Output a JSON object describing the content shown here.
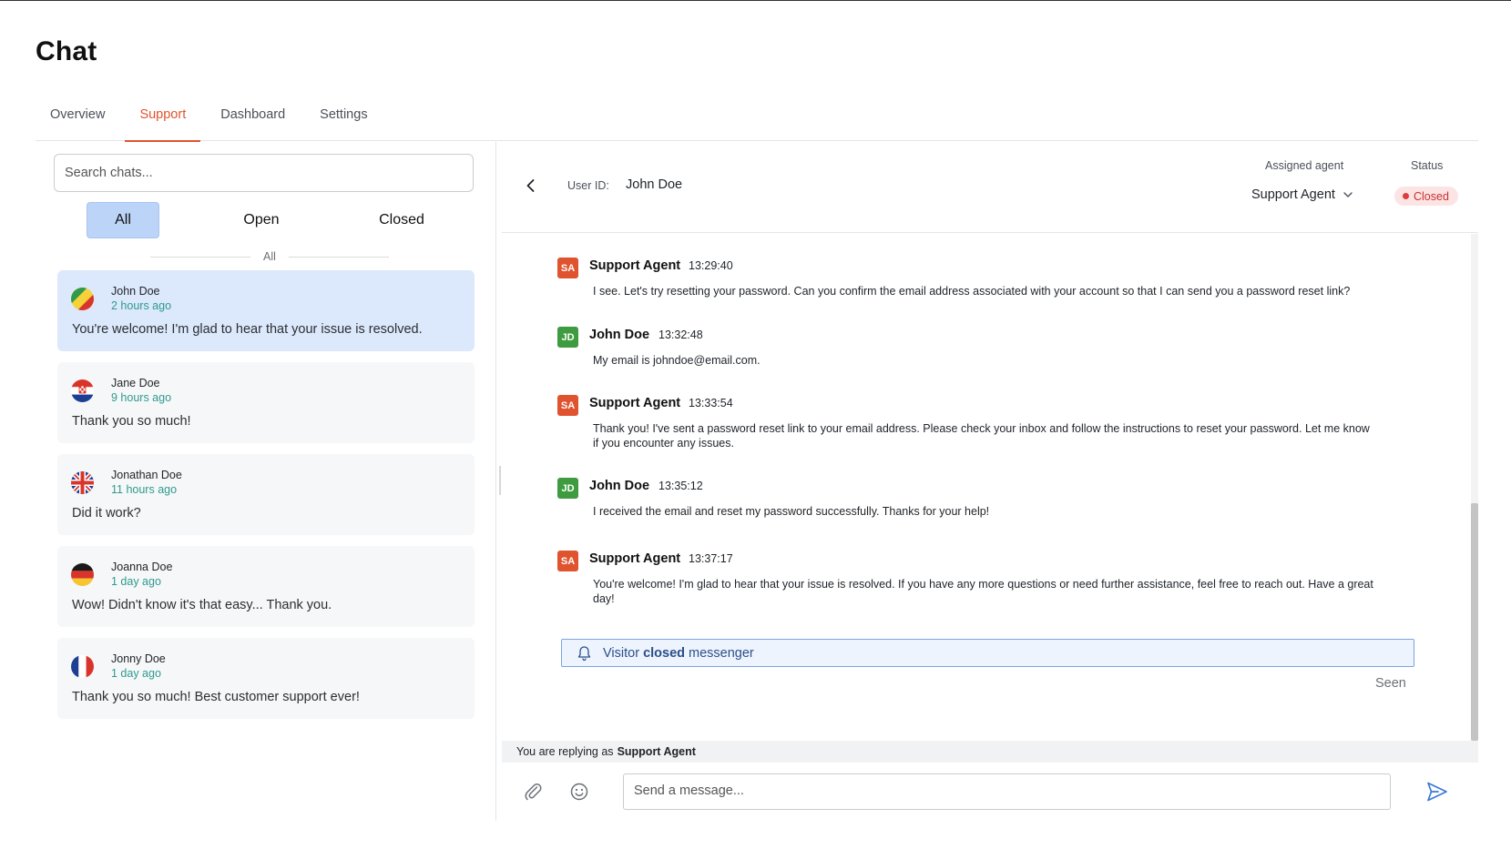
{
  "page": {
    "title": "Chat"
  },
  "tabs": [
    {
      "label": "Overview",
      "active": false
    },
    {
      "label": "Support",
      "active": true
    },
    {
      "label": "Dashboard",
      "active": false
    },
    {
      "label": "Settings",
      "active": false
    }
  ],
  "sidebar": {
    "search_placeholder": "Search chats...",
    "filters": [
      {
        "label": "All",
        "active": true
      },
      {
        "label": "Open",
        "active": false
      },
      {
        "label": "Closed",
        "active": false
      }
    ],
    "group_label": "All",
    "chats": [
      {
        "name": "John Doe",
        "time": "2 hours ago",
        "message": "You're welcome! I'm glad to hear that your issue is resolved.",
        "flag": "congo-flag-icon",
        "selected": true
      },
      {
        "name": "Jane Doe",
        "time": "9 hours ago",
        "message": "Thank you so much!",
        "flag": "croatia-flag-icon",
        "selected": false
      },
      {
        "name": "Jonathan Doe",
        "time": "11 hours ago",
        "message": "Did it work?",
        "flag": "uk-flag-icon",
        "selected": false
      },
      {
        "name": "Joanna Doe",
        "time": "1 day ago",
        "message": "Wow! Didn't know it's that easy... Thank you.",
        "flag": "germany-flag-icon",
        "selected": false
      },
      {
        "name": "Jonny Doe",
        "time": "1 day ago",
        "message": "Thank you so much! Best customer support ever!",
        "flag": "france-flag-icon",
        "selected": false
      }
    ]
  },
  "conversation": {
    "user_id_label": "User ID:",
    "user_id_value": "John Doe",
    "assigned_agent_label": "Assigned agent",
    "assigned_agent_value": "Support Agent",
    "status_label": "Status",
    "status_value": "Closed",
    "messages": [
      {
        "initials": "SA",
        "role": "agent",
        "sender": "Support Agent",
        "time": "13:29:40",
        "text": "I see. Let's try resetting your password. Can you confirm the email address associated with your account so that I can send you a password reset link?"
      },
      {
        "initials": "JD",
        "role": "user",
        "sender": "John Doe",
        "time": "13:32:48",
        "text": "My email is johndoe@email.com."
      },
      {
        "initials": "SA",
        "role": "agent",
        "sender": "Support Agent",
        "time": "13:33:54",
        "text": "Thank you! I've sent a password reset link to your email address. Please check your inbox and follow the instructions to reset your password. Let me know if you encounter any issues."
      },
      {
        "initials": "JD",
        "role": "user",
        "sender": "John Doe",
        "time": "13:35:12",
        "text": "I received the email and reset my password successfully. Thanks for your help!"
      },
      {
        "initials": "SA",
        "role": "agent",
        "sender": "Support Agent",
        "time": "13:37:17",
        "text": "You're welcome! I'm glad to hear that your issue is resolved. If you have any more questions or need further assistance, feel free to reach out. Have a great day!"
      }
    ],
    "event": {
      "prefix": "Visitor",
      "emphasis": "closed",
      "suffix": "messenger"
    },
    "seen_label": "Seen",
    "reply_prefix": "You are replying as",
    "reply_agent": "Support Agent",
    "composer_placeholder": "Send a message..."
  },
  "colors": {
    "accent": "#e0532f",
    "agent_avatar": "#e0532f",
    "user_avatar": "#3f9b3f",
    "selected_chat": "#dce8fb",
    "timestamp_teal": "#2f9a8f",
    "status_closed": "#c8312f"
  }
}
